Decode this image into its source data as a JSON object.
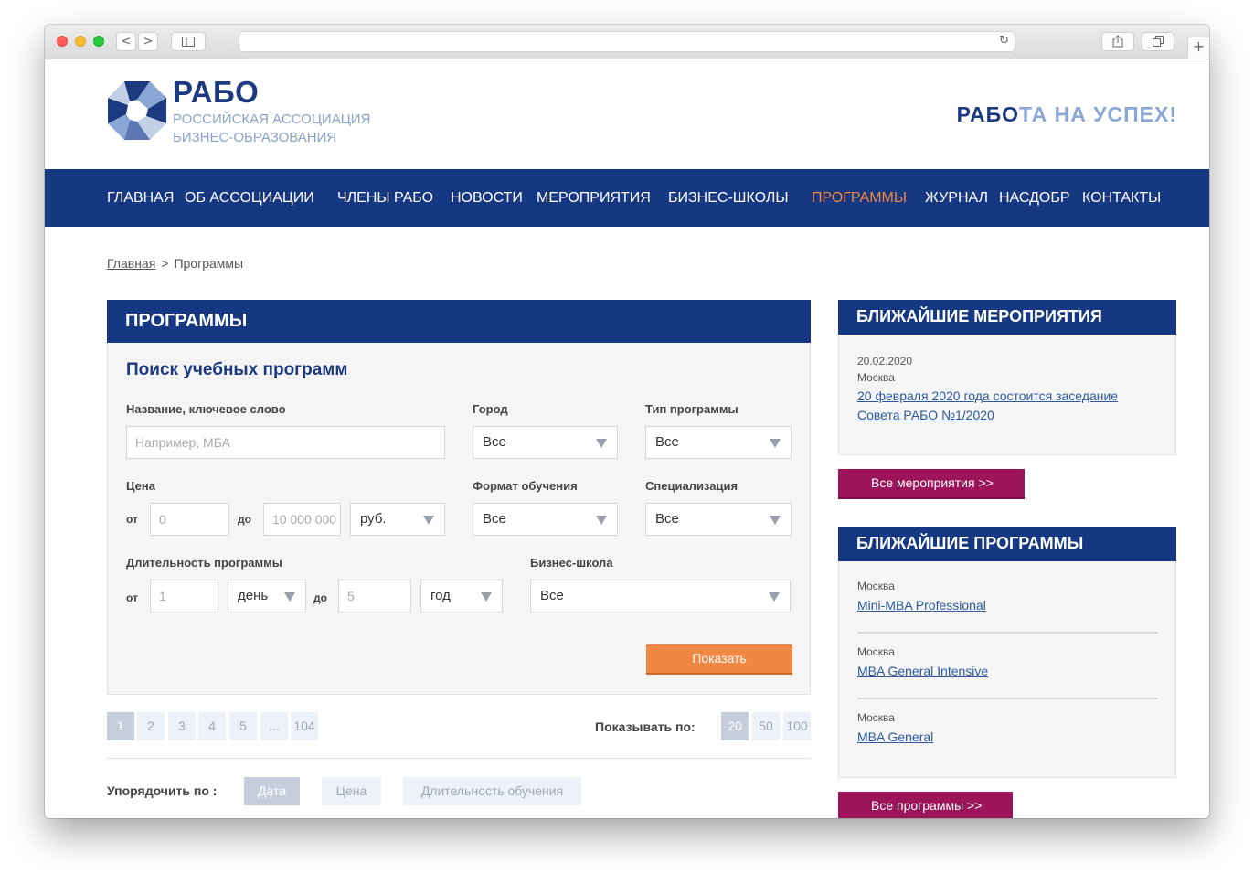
{
  "browser": {
    "back": "<",
    "forward": ">",
    "reload": "↻",
    "add_tab": "+"
  },
  "header": {
    "logo_title": "РАБО",
    "logo_sub_line1": "РОССИЙСКАЯ АССОЦИАЦИЯ",
    "logo_sub_line2": "БИЗНЕС-ОБРАЗОВАНИЯ",
    "slogan_part1": "РАБО",
    "slogan_part2": "ТА НА УСПЕХ!"
  },
  "nav": {
    "items": [
      "ГЛАВНАЯ",
      "ОБ АССОЦИАЦИИ",
      "ЧЛЕНЫ РАБО",
      "НОВОСТИ",
      "МЕРОПРИЯТИЯ",
      "БИЗНЕС-ШКОЛЫ",
      "ПРОГРАММЫ",
      "ЖУРНАЛ",
      "НАСДОБР",
      "КОНТАКТЫ"
    ],
    "active": "ПРОГРАММЫ"
  },
  "breadcrumb": {
    "home": "Главная",
    "sep": ">",
    "current": "Программы"
  },
  "main": {
    "title": "ПРОГРАММЫ",
    "search_title": "Поиск учебных программ",
    "fields": {
      "keyword_label": "Название, ключевое слово",
      "keyword_placeholder": "Например, МБА",
      "city_label": "Город",
      "city_value": "Все",
      "type_label": "Тип программы",
      "type_value": "Все",
      "price_label": "Цена",
      "from": "от",
      "to": "до",
      "price_from_placeholder": "0",
      "price_to_placeholder": "10 000 000",
      "currency_value": "руб.",
      "format_label": "Формат обучения",
      "format_value": "Все",
      "spec_label": "Специализация",
      "spec_value": "Все",
      "duration_label": "Длительность программы",
      "dur_from_placeholder": "1",
      "dur_from_unit": "день",
      "dur_to_placeholder": "5",
      "dur_to_unit": "год",
      "school_label": "Бизнес-школа",
      "school_value": "Все"
    },
    "show_button": "Показать",
    "pagination": [
      "1",
      "2",
      "3",
      "4",
      "5",
      "...",
      "104"
    ],
    "current_page": "1",
    "per_page_label": "Показывать по:",
    "per_page_options": [
      "20",
      "50",
      "100"
    ],
    "per_page_selected": "20",
    "sort_label": "Упорядочить по :",
    "sort_options": [
      "Дата",
      "Цена",
      "Длительность обучения"
    ],
    "sort_selected": "Дата"
  },
  "sidebar": {
    "events_title": "БЛИЖАЙШИЕ МЕРОПРИЯТИЯ",
    "event": {
      "date": "20.02.2020",
      "city": "Москва",
      "title_line1": "20 февраля 2020 года состоится заседание",
      "title_line2": "Совета РАБО №1/2020"
    },
    "all_events_button": "Все мероприятия >>",
    "programs_title": "БЛИЖАЙШИЕ ПРОГРАММЫ",
    "programs": [
      {
        "city": "Москва",
        "name": "Mini-MBA Professional"
      },
      {
        "city": "Москва",
        "name": "MBA General Intensive"
      },
      {
        "city": "Москва",
        "name": "MBA General"
      }
    ],
    "all_programs_button": "Все программы >>"
  },
  "colors": {
    "brand_blue": "#163883",
    "accent_orange": "#f08742",
    "accent_purple": "#9c1459",
    "link_blue": "#2c5aa0"
  }
}
